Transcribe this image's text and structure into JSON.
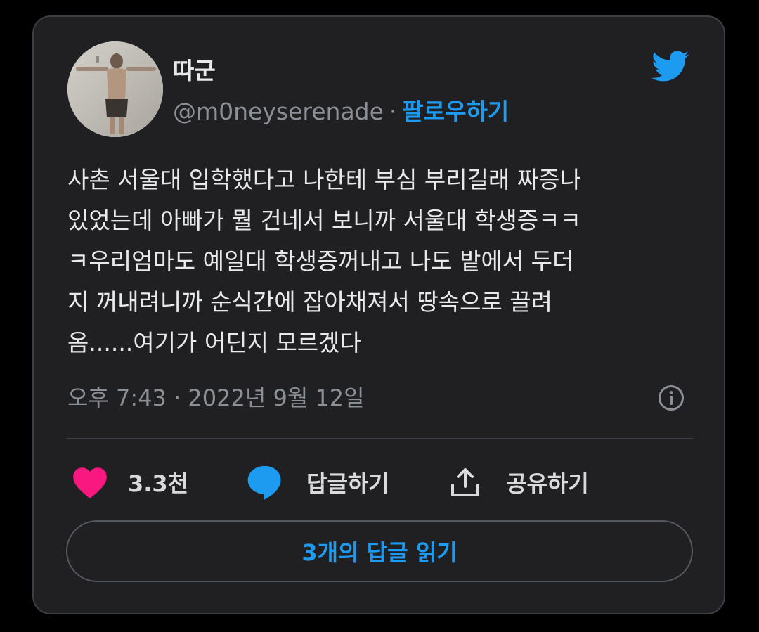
{
  "author": {
    "name": "따군",
    "handle": "@m0neyserenade",
    "separator": "·",
    "follow_label": "팔로우하기",
    "avatar_icon": "profile-photo"
  },
  "brand": {
    "icon": "twitter-bird-icon",
    "color": "#1d9bf0"
  },
  "tweet": {
    "lines": [
      "사촌 서울대 입학했다고 나한테 부심 부리길래 짜증나",
      "있었는데 아빠가 뭘 건네서 보니까 서울대 학생증ㅋㅋ",
      "ㅋ우리엄마도 예일대 학생증꺼내고 나도 밭에서 두더",
      "지 꺼내려니까 순식간에 잡아채져서 땅속으로 끌려",
      "옴......여기가 어딘지 모르겠다"
    ],
    "timestamp": "오후 7:43 · 2022년 9월 12일"
  },
  "actions": {
    "like_count": "3.3천",
    "reply_label": "답글하기",
    "share_label": "공유하기",
    "read_replies_label": "3개의 답글 읽기"
  },
  "colors": {
    "card_background": "#202023",
    "like": "#f91880",
    "accent": "#1d9bf0",
    "muted_text": "#8b9097"
  }
}
